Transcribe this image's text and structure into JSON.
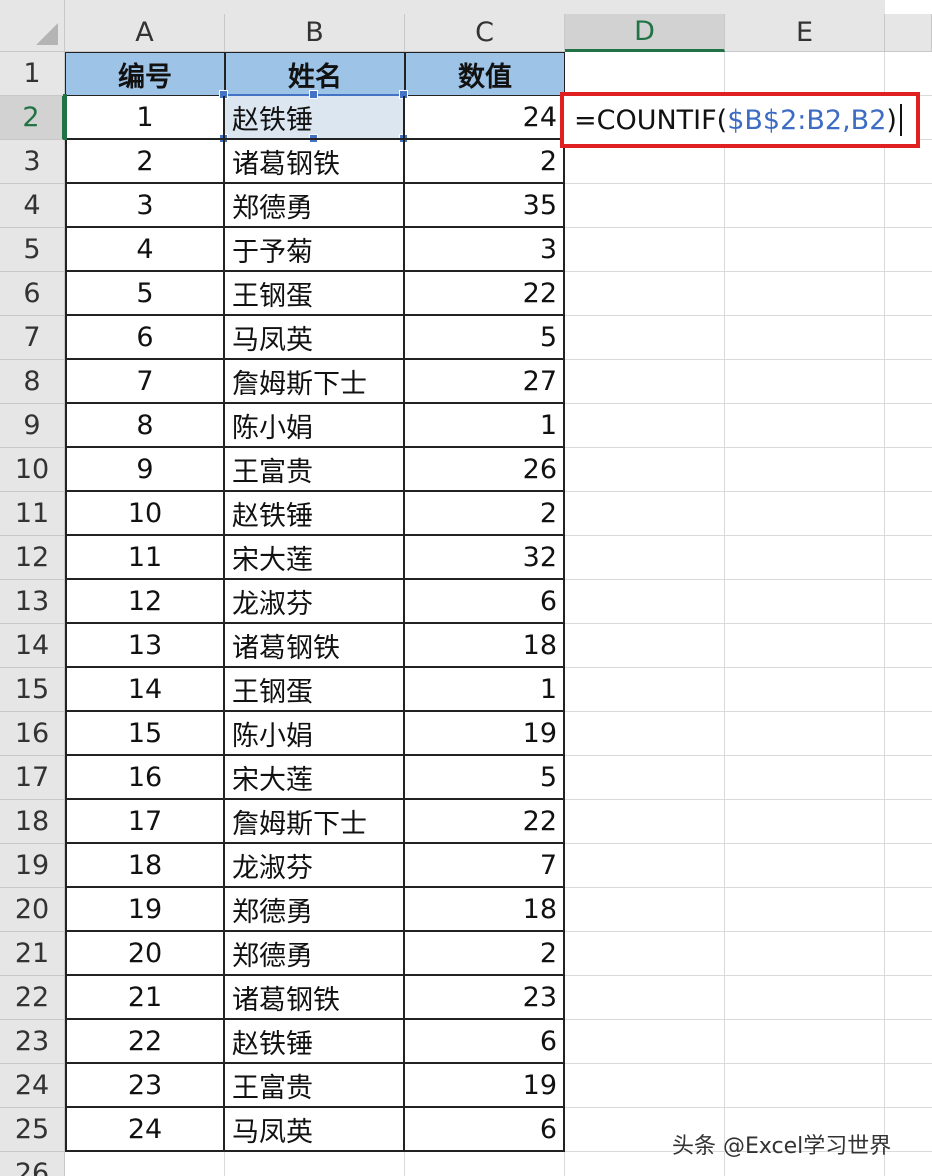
{
  "columns": [
    "A",
    "B",
    "C",
    "D",
    "E"
  ],
  "active_column": "D",
  "row_numbers": [
    "1",
    "2",
    "3",
    "4",
    "5",
    "6",
    "7",
    "8",
    "9",
    "10",
    "11",
    "12",
    "13",
    "14",
    "15",
    "16",
    "17",
    "18",
    "19",
    "20",
    "21",
    "22",
    "23",
    "24",
    "25",
    "26"
  ],
  "active_row": "2",
  "headers": {
    "a": "编号",
    "b": "姓名",
    "c": "数值"
  },
  "rows": [
    {
      "a": "1",
      "b": "赵铁锤",
      "c": "24"
    },
    {
      "a": "2",
      "b": "诸葛钢铁",
      "c": "2"
    },
    {
      "a": "3",
      "b": "郑德勇",
      "c": "35"
    },
    {
      "a": "4",
      "b": "于予菊",
      "c": "3"
    },
    {
      "a": "5",
      "b": "王钢蛋",
      "c": "22"
    },
    {
      "a": "6",
      "b": "马凤英",
      "c": "5"
    },
    {
      "a": "7",
      "b": "詹姆斯下士",
      "c": "27"
    },
    {
      "a": "8",
      "b": "陈小娟",
      "c": "1"
    },
    {
      "a": "9",
      "b": "王富贵",
      "c": "26"
    },
    {
      "a": "10",
      "b": "赵铁锤",
      "c": "2"
    },
    {
      "a": "11",
      "b": "宋大莲",
      "c": "32"
    },
    {
      "a": "12",
      "b": "龙淑芬",
      "c": "6"
    },
    {
      "a": "13",
      "b": "诸葛钢铁",
      "c": "18"
    },
    {
      "a": "14",
      "b": "王钢蛋",
      "c": "1"
    },
    {
      "a": "15",
      "b": "陈小娟",
      "c": "19"
    },
    {
      "a": "16",
      "b": "宋大莲",
      "c": "5"
    },
    {
      "a": "17",
      "b": "詹姆斯下士",
      "c": "22"
    },
    {
      "a": "18",
      "b": "龙淑芬",
      "c": "7"
    },
    {
      "a": "19",
      "b": "郑德勇",
      "c": "18"
    },
    {
      "a": "20",
      "b": "郑德勇",
      "c": "2"
    },
    {
      "a": "21",
      "b": "诸葛钢铁",
      "c": "23"
    },
    {
      "a": "22",
      "b": "赵铁锤",
      "c": "6"
    },
    {
      "a": "23",
      "b": "王富贵",
      "c": "19"
    },
    {
      "a": "24",
      "b": "马凤英",
      "c": "6"
    }
  ],
  "formula": {
    "prefix": "=COUNTIF(",
    "range_ref": "$B$2:B2",
    "comma": ",",
    "cell_ref": "B2",
    "suffix": ")"
  },
  "watermark": "头条 @Excel学习世界",
  "colors": {
    "header_fill": "#9dc3e6",
    "selection_fill": "#dce6f1",
    "selection_border": "#4472c4",
    "formula_highlight": "#e02020",
    "ref_text": "#3c6cc4",
    "active_header": "#217346"
  }
}
